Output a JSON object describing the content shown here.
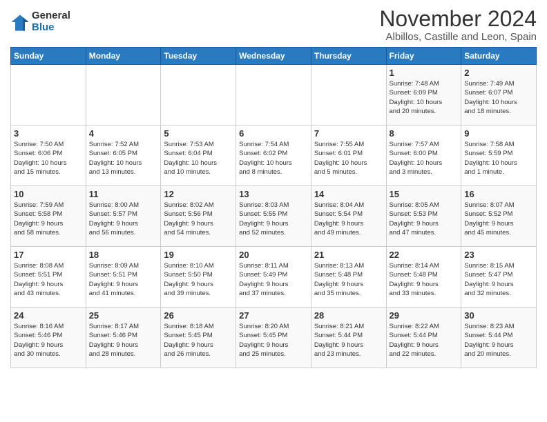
{
  "logo": {
    "general": "General",
    "blue": "Blue"
  },
  "title": "November 2024",
  "location": "Albillos, Castille and Leon, Spain",
  "days_of_week": [
    "Sunday",
    "Monday",
    "Tuesday",
    "Wednesday",
    "Thursday",
    "Friday",
    "Saturday"
  ],
  "weeks": [
    [
      {
        "day": "",
        "info": ""
      },
      {
        "day": "",
        "info": ""
      },
      {
        "day": "",
        "info": ""
      },
      {
        "day": "",
        "info": ""
      },
      {
        "day": "",
        "info": ""
      },
      {
        "day": "1",
        "info": "Sunrise: 7:48 AM\nSunset: 6:09 PM\nDaylight: 10 hours\nand 20 minutes."
      },
      {
        "day": "2",
        "info": "Sunrise: 7:49 AM\nSunset: 6:07 PM\nDaylight: 10 hours\nand 18 minutes."
      }
    ],
    [
      {
        "day": "3",
        "info": "Sunrise: 7:50 AM\nSunset: 6:06 PM\nDaylight: 10 hours\nand 15 minutes."
      },
      {
        "day": "4",
        "info": "Sunrise: 7:52 AM\nSunset: 6:05 PM\nDaylight: 10 hours\nand 13 minutes."
      },
      {
        "day": "5",
        "info": "Sunrise: 7:53 AM\nSunset: 6:04 PM\nDaylight: 10 hours\nand 10 minutes."
      },
      {
        "day": "6",
        "info": "Sunrise: 7:54 AM\nSunset: 6:02 PM\nDaylight: 10 hours\nand 8 minutes."
      },
      {
        "day": "7",
        "info": "Sunrise: 7:55 AM\nSunset: 6:01 PM\nDaylight: 10 hours\nand 5 minutes."
      },
      {
        "day": "8",
        "info": "Sunrise: 7:57 AM\nSunset: 6:00 PM\nDaylight: 10 hours\nand 3 minutes."
      },
      {
        "day": "9",
        "info": "Sunrise: 7:58 AM\nSunset: 5:59 PM\nDaylight: 10 hours\nand 1 minute."
      }
    ],
    [
      {
        "day": "10",
        "info": "Sunrise: 7:59 AM\nSunset: 5:58 PM\nDaylight: 9 hours\nand 58 minutes."
      },
      {
        "day": "11",
        "info": "Sunrise: 8:00 AM\nSunset: 5:57 PM\nDaylight: 9 hours\nand 56 minutes."
      },
      {
        "day": "12",
        "info": "Sunrise: 8:02 AM\nSunset: 5:56 PM\nDaylight: 9 hours\nand 54 minutes."
      },
      {
        "day": "13",
        "info": "Sunrise: 8:03 AM\nSunset: 5:55 PM\nDaylight: 9 hours\nand 52 minutes."
      },
      {
        "day": "14",
        "info": "Sunrise: 8:04 AM\nSunset: 5:54 PM\nDaylight: 9 hours\nand 49 minutes."
      },
      {
        "day": "15",
        "info": "Sunrise: 8:05 AM\nSunset: 5:53 PM\nDaylight: 9 hours\nand 47 minutes."
      },
      {
        "day": "16",
        "info": "Sunrise: 8:07 AM\nSunset: 5:52 PM\nDaylight: 9 hours\nand 45 minutes."
      }
    ],
    [
      {
        "day": "17",
        "info": "Sunrise: 8:08 AM\nSunset: 5:51 PM\nDaylight: 9 hours\nand 43 minutes."
      },
      {
        "day": "18",
        "info": "Sunrise: 8:09 AM\nSunset: 5:51 PM\nDaylight: 9 hours\nand 41 minutes."
      },
      {
        "day": "19",
        "info": "Sunrise: 8:10 AM\nSunset: 5:50 PM\nDaylight: 9 hours\nand 39 minutes."
      },
      {
        "day": "20",
        "info": "Sunrise: 8:11 AM\nSunset: 5:49 PM\nDaylight: 9 hours\nand 37 minutes."
      },
      {
        "day": "21",
        "info": "Sunrise: 8:13 AM\nSunset: 5:48 PM\nDaylight: 9 hours\nand 35 minutes."
      },
      {
        "day": "22",
        "info": "Sunrise: 8:14 AM\nSunset: 5:48 PM\nDaylight: 9 hours\nand 33 minutes."
      },
      {
        "day": "23",
        "info": "Sunrise: 8:15 AM\nSunset: 5:47 PM\nDaylight: 9 hours\nand 32 minutes."
      }
    ],
    [
      {
        "day": "24",
        "info": "Sunrise: 8:16 AM\nSunset: 5:46 PM\nDaylight: 9 hours\nand 30 minutes."
      },
      {
        "day": "25",
        "info": "Sunrise: 8:17 AM\nSunset: 5:46 PM\nDaylight: 9 hours\nand 28 minutes."
      },
      {
        "day": "26",
        "info": "Sunrise: 8:18 AM\nSunset: 5:45 PM\nDaylight: 9 hours\nand 26 minutes."
      },
      {
        "day": "27",
        "info": "Sunrise: 8:20 AM\nSunset: 5:45 PM\nDaylight: 9 hours\nand 25 minutes."
      },
      {
        "day": "28",
        "info": "Sunrise: 8:21 AM\nSunset: 5:44 PM\nDaylight: 9 hours\nand 23 minutes."
      },
      {
        "day": "29",
        "info": "Sunrise: 8:22 AM\nSunset: 5:44 PM\nDaylight: 9 hours\nand 22 minutes."
      },
      {
        "day": "30",
        "info": "Sunrise: 8:23 AM\nSunset: 5:44 PM\nDaylight: 9 hours\nand 20 minutes."
      }
    ]
  ]
}
